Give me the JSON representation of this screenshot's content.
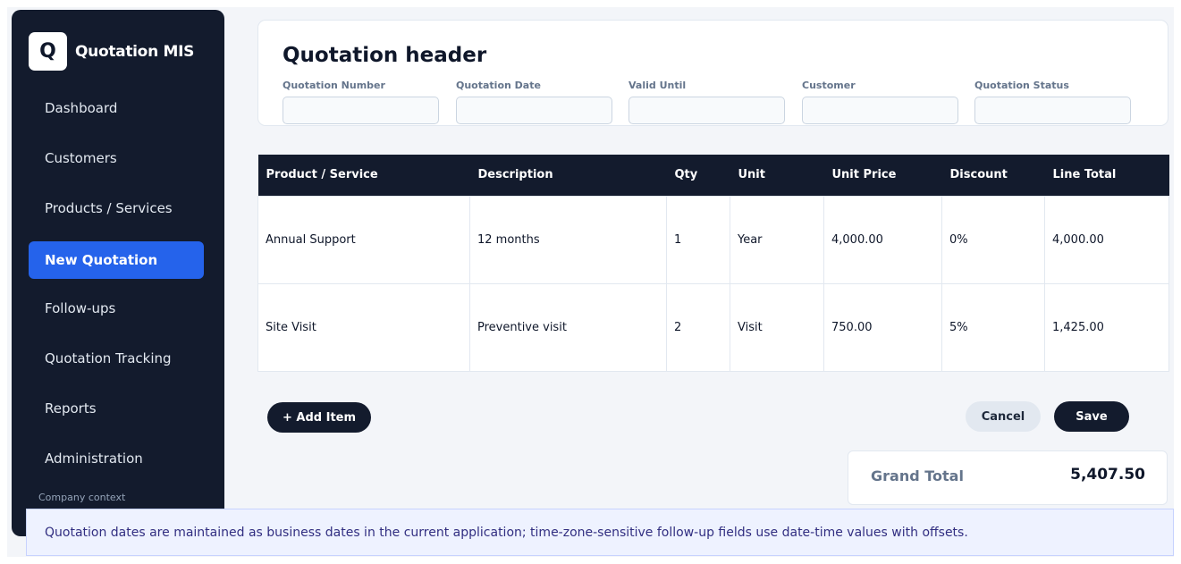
{
  "sidebar": {
    "brand_initial": "Q",
    "brand_name": "Quotation MIS",
    "items": [
      {
        "label": "Dashboard"
      },
      {
        "label": "Customers"
      },
      {
        "label": "Products / Services"
      },
      {
        "label": "New Quotation",
        "active": true
      },
      {
        "label": "Follow-ups"
      },
      {
        "label": "Quotation Tracking"
      },
      {
        "label": "Reports"
      },
      {
        "label": "Administration"
      }
    ],
    "company_context": "Company context"
  },
  "header": {
    "title": "Quotation header",
    "fields": [
      {
        "label": "Quotation Number",
        "value": ""
      },
      {
        "label": "Quotation Date",
        "value": ""
      },
      {
        "label": "Valid Until",
        "value": ""
      },
      {
        "label": "Customer",
        "value": ""
      },
      {
        "label": "Quotation Status",
        "value": ""
      }
    ]
  },
  "table": {
    "columns": [
      "Product / Service",
      "Description",
      "Qty",
      "Unit",
      "Unit Price",
      "Discount",
      "Line Total"
    ],
    "rows": [
      [
        "Annual Support",
        "12 months",
        "1",
        "Year",
        "4,000.00",
        "0%",
        "4,000.00"
      ],
      [
        "Site Visit",
        "Preventive visit",
        "2",
        "Visit",
        "750.00",
        "5%",
        "1,425.00"
      ]
    ]
  },
  "actions": {
    "add_item": "+ Add Item",
    "cancel": "Cancel",
    "save": "Save"
  },
  "grand_total": {
    "label": "Grand Total",
    "value": "5,407.50"
  },
  "notice": "Quotation dates are maintained as business dates in the current application; time-zone-sensitive follow-up fields use date-time values with offsets.",
  "colors": {
    "sidebar_bg": "#131b2d",
    "accent": "#2563eb",
    "page_bg": "#f3f5f9"
  }
}
